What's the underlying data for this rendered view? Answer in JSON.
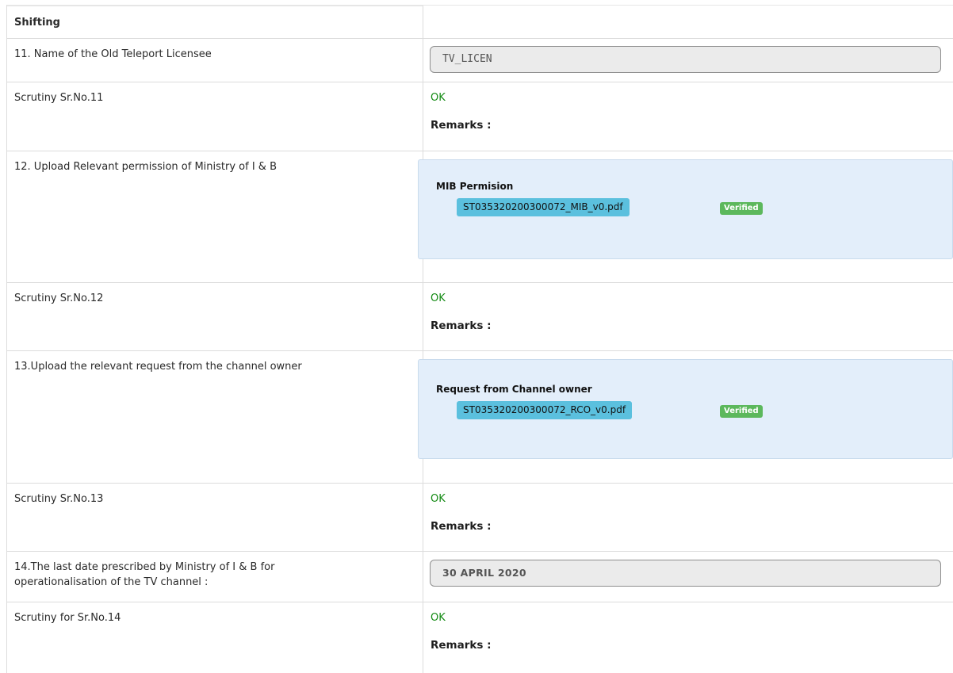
{
  "section_title": "Shifting",
  "rows": {
    "r11": {
      "label": "11. Name of the Old Teleport Licensee",
      "value": "TV_LICEN"
    },
    "s11": {
      "label": "Scrutiny Sr.No.11",
      "status": "OK",
      "remarks": "Remarks :"
    },
    "r12": {
      "label": "12. Upload Relevant permission of Ministry of I & B",
      "panel_title": "MIB Permision",
      "file": "ST035320200300072_MIB_v0.pdf",
      "badge": "Verified"
    },
    "s12": {
      "label": "Scrutiny Sr.No.12",
      "status": "OK",
      "remarks": "Remarks :"
    },
    "r13": {
      "label": "13.Upload the relevant request from the channel owner",
      "panel_title": "Request from Channel owner",
      "file": "ST035320200300072_RCO_v0.pdf",
      "badge": "Verified"
    },
    "s13": {
      "label": "Scrutiny Sr.No.13",
      "status": "OK",
      "remarks": "Remarks :"
    },
    "r14": {
      "label_line1": "14.The last date prescribed by Ministry of I & B for",
      "label_line2": "operationalisation of the TV channel :",
      "value": "30 APRIL 2020"
    },
    "s14": {
      "label": "Scrutiny for Sr.No.14",
      "status": "OK",
      "remarks": "Remarks :"
    }
  },
  "colors": {
    "ok_green": "#138a13",
    "file_chip": "#5bc0de",
    "verified_badge": "#5cb85c",
    "panel_bg": "#e3eefa",
    "field_bg": "#ebebeb"
  }
}
